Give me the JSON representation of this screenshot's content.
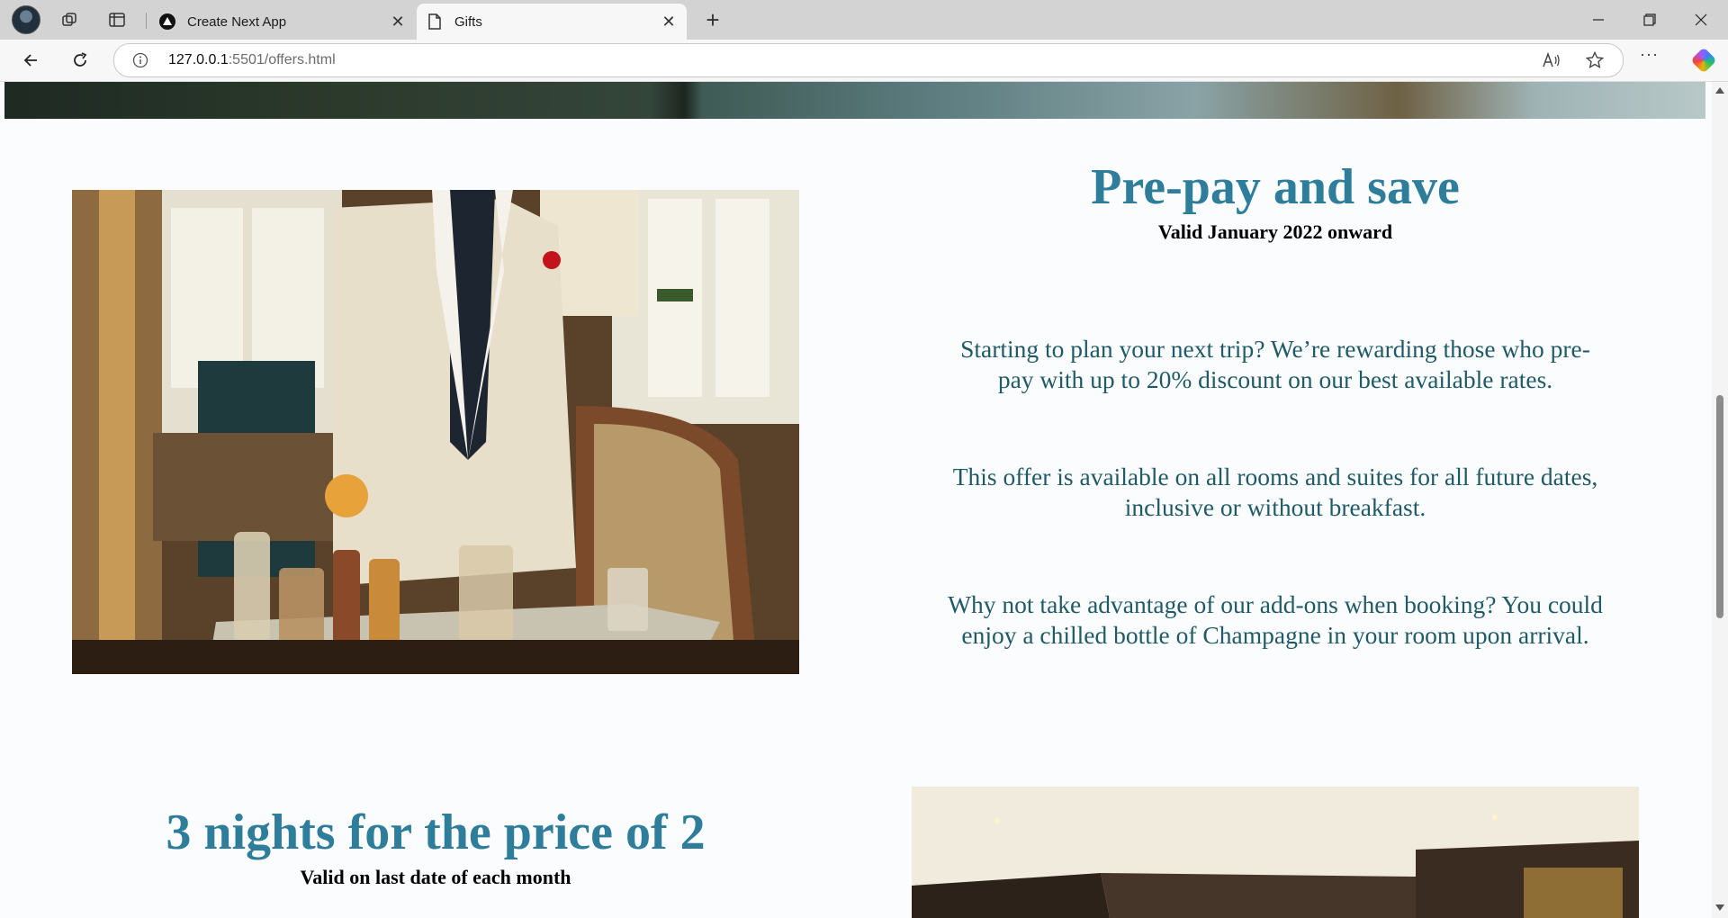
{
  "browser": {
    "tabs": [
      {
        "title": "Create Next App",
        "active": false,
        "icon": "nextjs-icon"
      },
      {
        "title": "Gifts",
        "active": true,
        "icon": "page-icon"
      }
    ],
    "url": {
      "host": "127.0.0.1",
      "path": ":5501/offers.html"
    }
  },
  "offers": [
    {
      "title": "Pre-pay and save",
      "valid": "Valid January 2022 onward",
      "paragraphs": [
        "Starting to plan your next trip? We’re rewarding those who pre-pay with up to 20% discount on our best available rates.",
        "This offer is available on all rooms and suites for all future dates, inclusive or without breakfast.",
        "Why not take advantage of our add-ons when booking? You could enjoy a chilled bottle of Champagne in your room upon arrival."
      ]
    },
    {
      "title": "3 nights for the price of 2",
      "valid": "Valid on last date of each month"
    }
  ],
  "colors": {
    "accent": "#2e7d9a",
    "body_text": "#1f5a66",
    "page_bg": "#fbfcfe"
  }
}
